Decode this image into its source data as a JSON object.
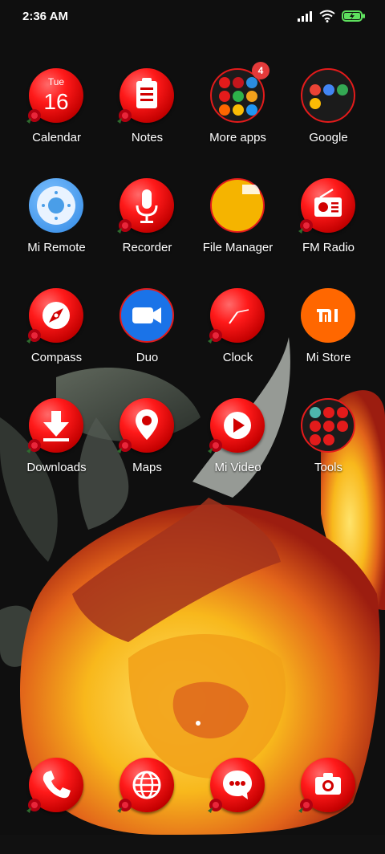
{
  "status_bar": {
    "time": "2:36 AM",
    "icons": [
      "signal-icon",
      "wifi-icon",
      "battery-charging-icon"
    ]
  },
  "apps": [
    {
      "label": "Calendar",
      "icon": "calendar-icon",
      "calendar_day": "Tue",
      "calendar_date": "16"
    },
    {
      "label": "Notes",
      "icon": "clipboard-icon"
    },
    {
      "label": "More apps",
      "icon": "folder-icon",
      "badge": "4"
    },
    {
      "label": "Google",
      "icon": "folder-icon"
    },
    {
      "label": "Mi Remote",
      "icon": "remote-icon"
    },
    {
      "label": "Recorder",
      "icon": "microphone-icon"
    },
    {
      "label": "File Manager",
      "icon": "folder-file-icon"
    },
    {
      "label": "FM Radio",
      "icon": "radio-icon"
    },
    {
      "label": "Compass",
      "icon": "compass-icon"
    },
    {
      "label": "Duo",
      "icon": "video-camera-icon"
    },
    {
      "label": "Clock",
      "icon": "clock-icon"
    },
    {
      "label": "Mi Store",
      "icon": "mi-logo-icon"
    },
    {
      "label": "Downloads",
      "icon": "download-arrow-icon"
    },
    {
      "label": "Maps",
      "icon": "map-pin-icon"
    },
    {
      "label": "Mi Video",
      "icon": "play-icon"
    },
    {
      "label": "Tools",
      "icon": "folder-icon"
    }
  ],
  "dock": [
    {
      "icon": "phone-icon"
    },
    {
      "icon": "globe-icon"
    },
    {
      "icon": "chat-bubble-icon"
    },
    {
      "icon": "camera-icon"
    }
  ],
  "colors": {
    "accent_red": "#e31b1b",
    "duo_blue": "#1a73e8",
    "mi_orange": "#ff6700",
    "file_manager_yellow": "#f5b400",
    "remote_blue": "#4a9ee8"
  }
}
